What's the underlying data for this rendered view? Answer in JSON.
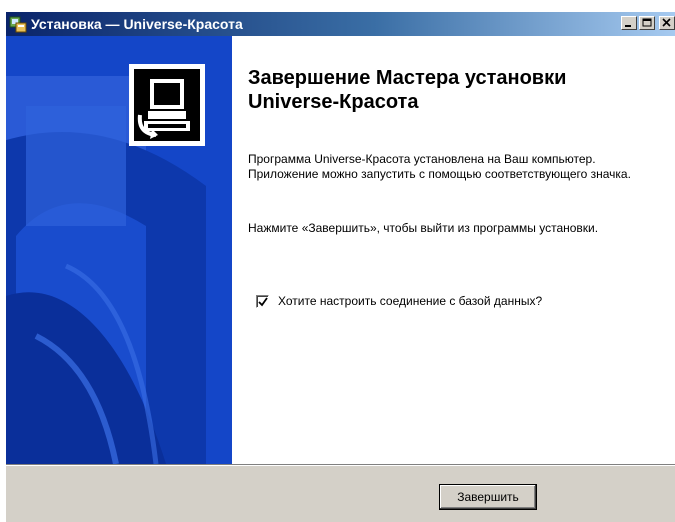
{
  "window": {
    "title": "Установка — Universe-Красота",
    "icon": "installer-icon",
    "controls": [
      "minimize-icon",
      "maximize-icon",
      "close-icon"
    ],
    "titlebar_color": "#0a246a"
  },
  "main": {
    "heading": "Завершение Мастера установки Universe-Красота",
    "paragraph1": "Программа Universe-Красота установлена на Ваш компьютер. Приложение можно запустить с помощью соответствующего значка.",
    "paragraph2": "Нажмите «Завершить», чтобы выйти из программы установки.",
    "checkbox": {
      "label": "Хотите настроить соединение с базой данных?",
      "checked": true
    }
  },
  "side_panel": {
    "color": "#1040c0",
    "logo": "setup-computer-icon"
  },
  "footer": {
    "finish_label": "Завершить"
  }
}
